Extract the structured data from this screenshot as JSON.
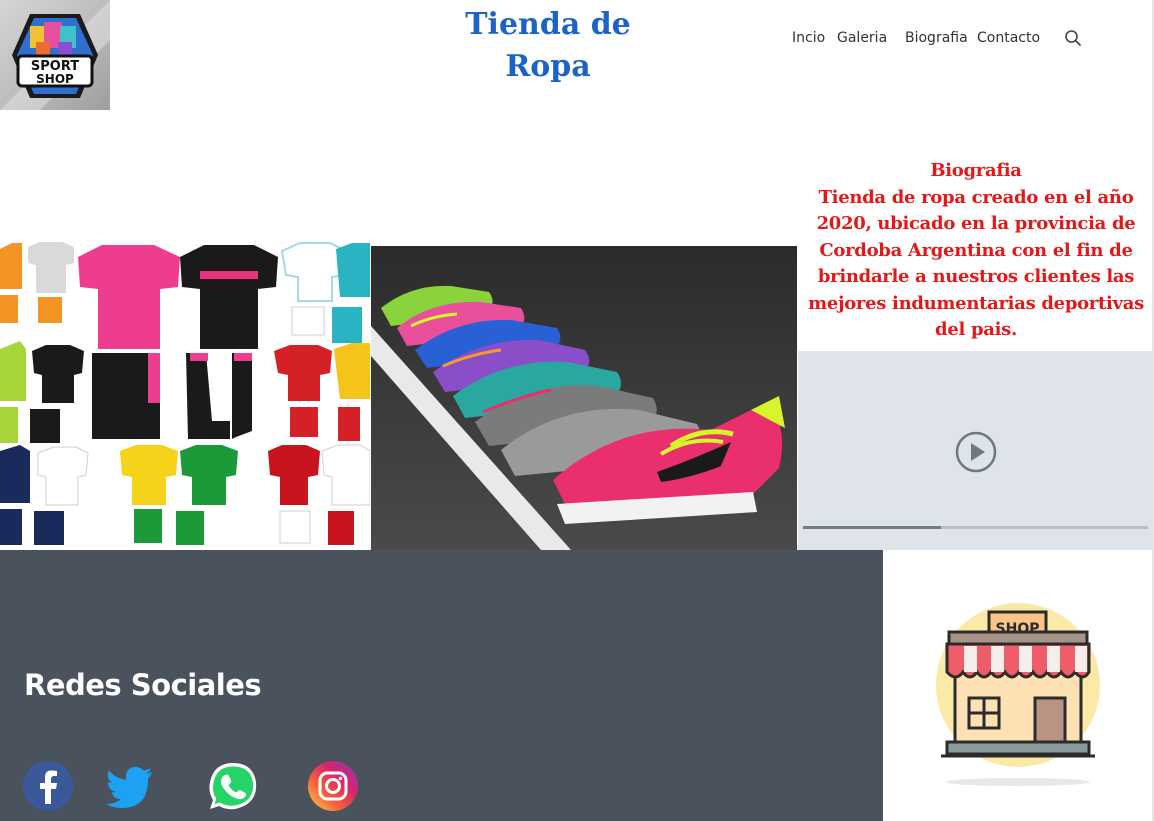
{
  "header": {
    "logo_text_line1": "SPORT",
    "logo_text_line2": "SHOP",
    "title_line1": "Tienda de",
    "title_line2": "Ropa",
    "nav": [
      {
        "label": "Incio"
      },
      {
        "label": "Galeria"
      },
      {
        "label": "Biografia"
      },
      {
        "label": "Contacto"
      }
    ],
    "search_icon": "search-icon"
  },
  "gallery": {
    "clothes_image": "soccer-uniforms-image",
    "shoes_image": "running-shoes-image"
  },
  "bio": {
    "lines": [
      "Biografia",
      "Tienda de ropa creado en el año",
      "2020, ubicado en la provincia de",
      "Cordoba Argentina con el fin de",
      "brindarle a nuestros clientes las",
      "mejores indumentarias deportivas",
      "del pais."
    ],
    "color": "#e31818"
  },
  "video": {
    "play_icon": "play-icon",
    "progress": 0.4
  },
  "footer": {
    "social_title": "Redes Sociales",
    "icons": [
      "facebook-icon",
      "twitter-icon",
      "whatsapp-icon",
      "instagram-icon"
    ],
    "shop_sign": "SHOP",
    "background": "#4a525d"
  },
  "colors": {
    "title_blue": "#1c63c7",
    "facebook": "#3b5998",
    "twitter": "#1da1f2",
    "whatsapp": "#25d366"
  }
}
